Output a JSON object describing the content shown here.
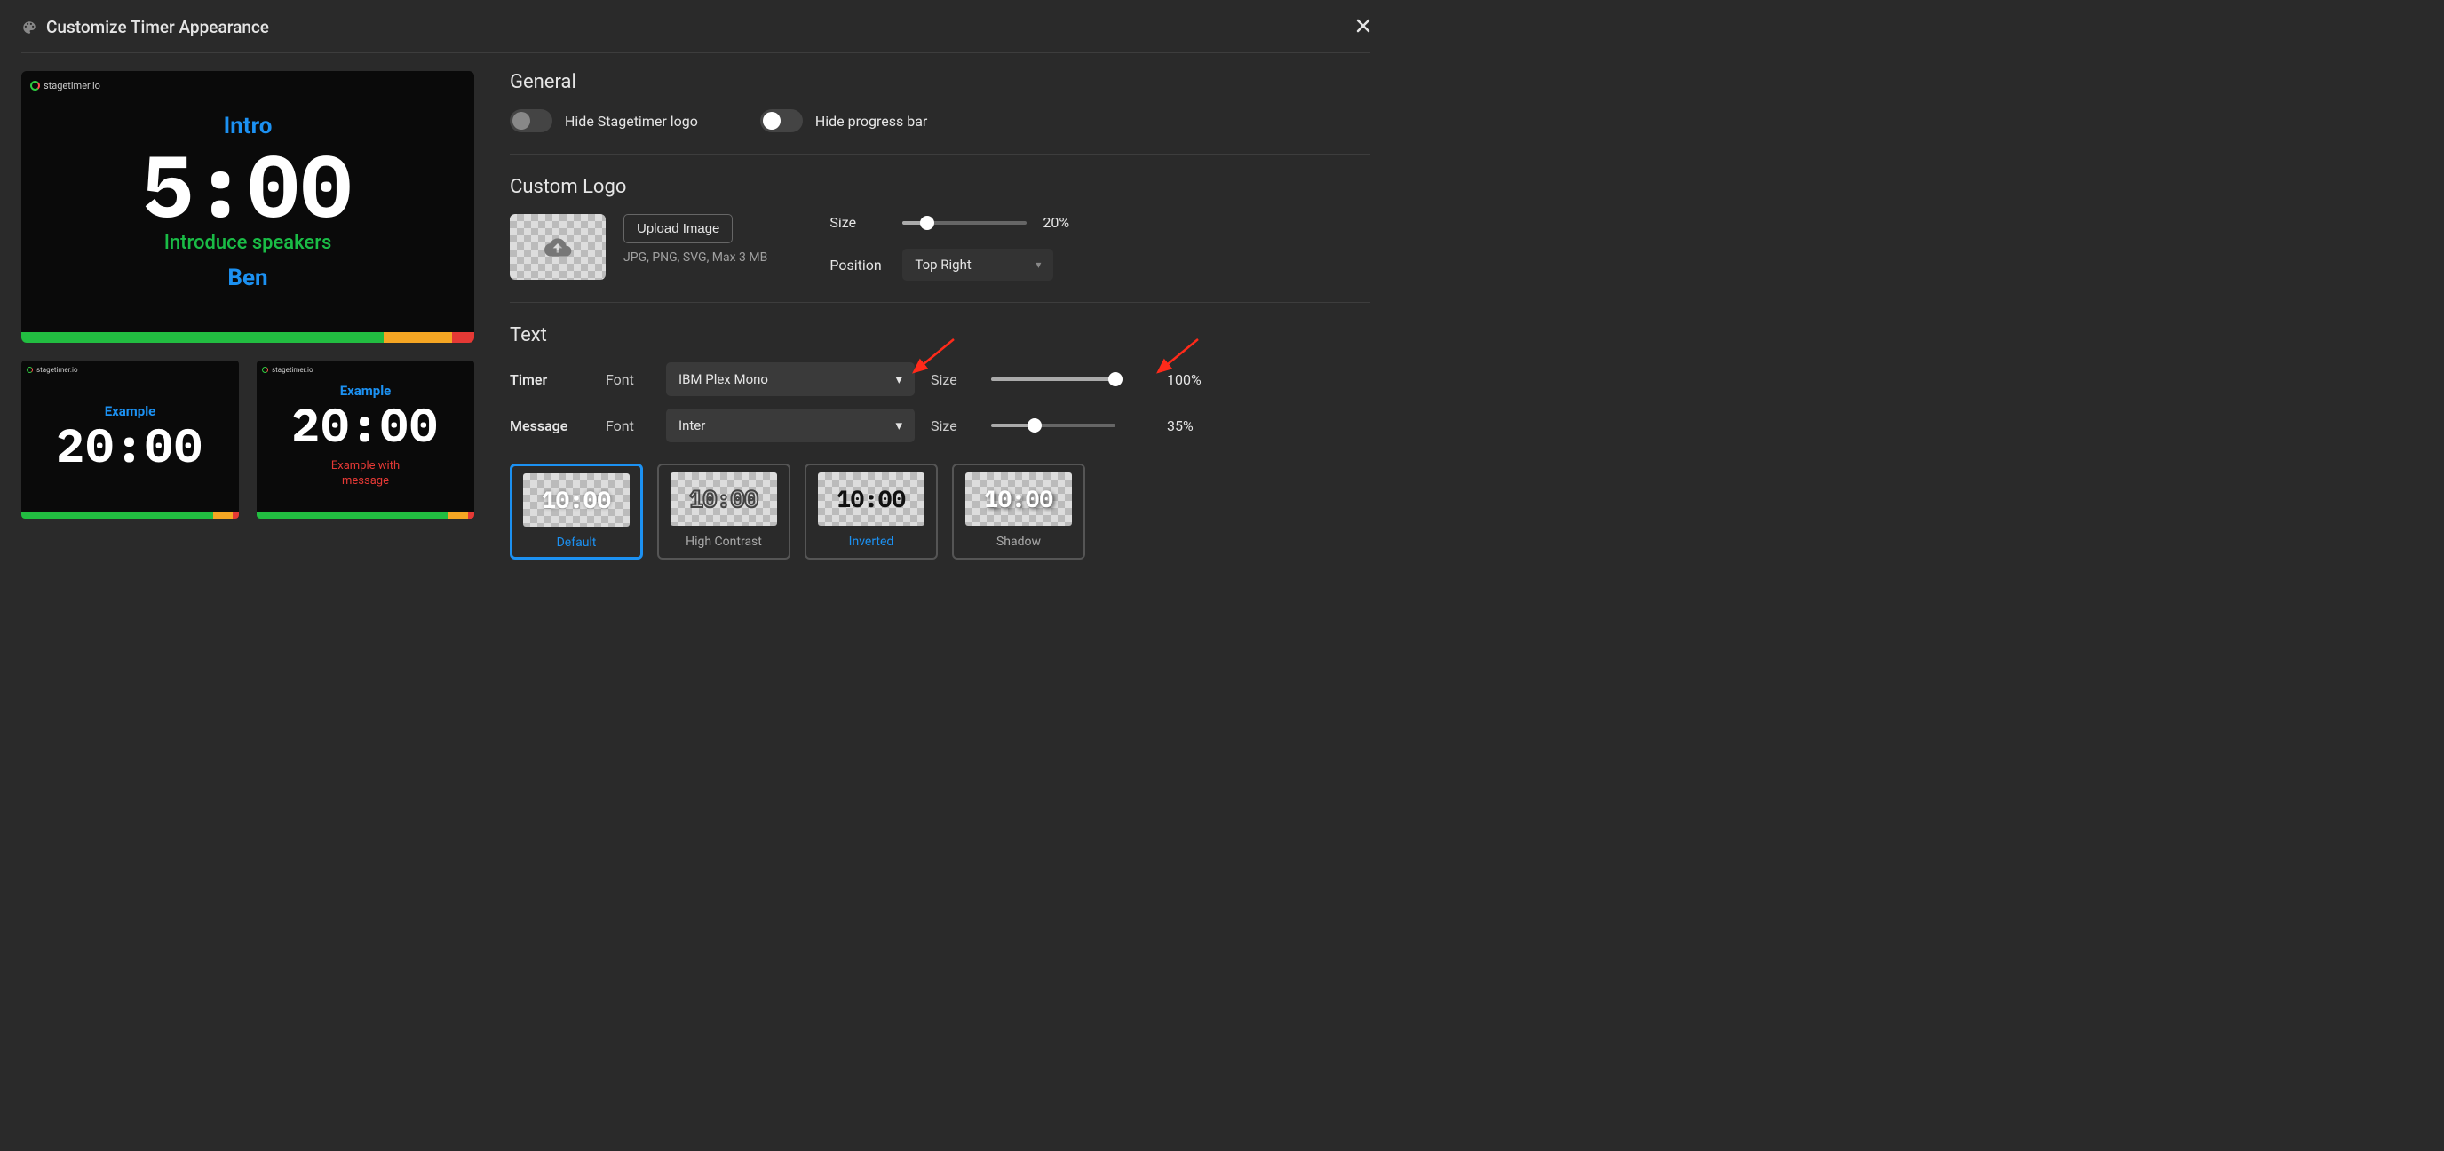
{
  "modal": {
    "title": "Customize Timer Appearance"
  },
  "preview": {
    "logo_text": "stagetimer.io",
    "main": {
      "title": "Intro",
      "time": "5:00",
      "subtitle": "Introduce speakers",
      "presenter": "Ben"
    },
    "small1": {
      "title": "Example",
      "time": "20:00"
    },
    "small2": {
      "title": "Example",
      "time": "20:00",
      "message_l1": "Example with",
      "message_l2": "message"
    }
  },
  "general": {
    "heading": "General",
    "hide_logo_label": "Hide Stagetimer logo",
    "hide_progress_label": "Hide progress bar"
  },
  "custom_logo": {
    "heading": "Custom Logo",
    "upload_btn": "Upload Image",
    "hint": "JPG, PNG, SVG, Max 3 MB",
    "size_label": "Size",
    "size_value": "20%",
    "size_percent": 20,
    "position_label": "Position",
    "position_value": "Top Right"
  },
  "text": {
    "heading": "Text",
    "timer_label": "Timer",
    "message_label": "Message",
    "font_label": "Font",
    "size_label": "Size",
    "timer_font": "IBM Plex Mono",
    "timer_size": "100%",
    "timer_size_percent": 100,
    "message_font": "Inter",
    "message_size": "35%",
    "message_size_percent": 35,
    "styles": {
      "sample": "10:00",
      "default": "Default",
      "high_contrast": "High Contrast",
      "inverted": "Inverted",
      "shadow": "Shadow"
    }
  }
}
